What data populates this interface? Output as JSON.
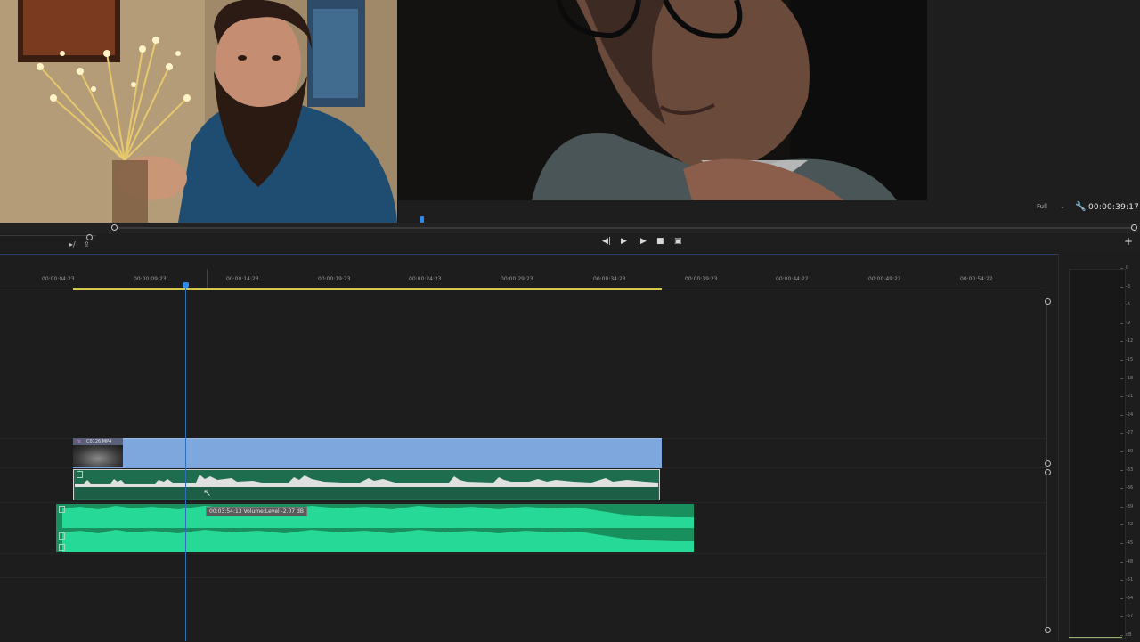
{
  "program_monitor": {
    "zoom": "Full",
    "timecode": "00:00:39:17"
  },
  "transport": {
    "step_back": "◀|",
    "play": "▶",
    "step_forward": "|▶",
    "export_frame": "■",
    "toggle_view": "▣",
    "add": "+"
  },
  "timeline": {
    "ruler_ticks": [
      "00:00:04:23",
      "00:00:09:23",
      "00:00:14:23",
      "00:00:19:23",
      "00:00:24:23",
      "00:00:29:23",
      "00:00:34:23",
      "00:00:39:23",
      "00:00:44:22",
      "00:00:49:22",
      "00:00:54:22"
    ],
    "video_clip": {
      "label": "C0126.MP4",
      "fx": "fx"
    },
    "tooltip": "00:03:54:13  Volume:Level  -2.07 dB"
  },
  "meter": {
    "db_labels": [
      "0",
      "-3",
      "-6",
      "-9",
      "-12",
      "-15",
      "-18",
      "-21",
      "-24",
      "-27",
      "-30",
      "-33",
      "-36",
      "-39",
      "-42",
      "-45",
      "-48",
      "-51",
      "-54",
      "-57",
      "dB"
    ]
  }
}
